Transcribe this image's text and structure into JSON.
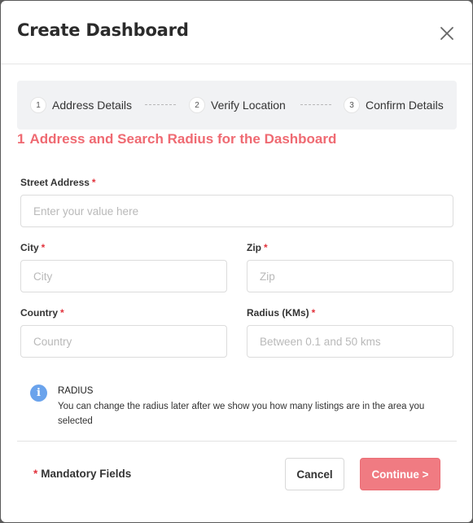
{
  "modal": {
    "title": "Create Dashboard",
    "close_icon": "close-icon"
  },
  "stepper": {
    "steps": [
      {
        "number": "1",
        "label": "Address Details"
      },
      {
        "number": "2",
        "label": "Verify Location"
      },
      {
        "number": "3",
        "label": "Confirm Details"
      }
    ]
  },
  "section": {
    "number": "1",
    "title": "Address and Search Radius for the Dashboard"
  },
  "form": {
    "required_marker": "*",
    "street": {
      "label": "Street Address",
      "value": "",
      "placeholder": "Enter your value here"
    },
    "city": {
      "label": "City",
      "value": "",
      "placeholder": "City"
    },
    "zip": {
      "label": "Zip",
      "value": "",
      "placeholder": "Zip"
    },
    "country": {
      "label": "Country",
      "value": "",
      "placeholder": "Country"
    },
    "radius": {
      "label": "Radius (KMs)",
      "value": "",
      "placeholder": "Between 0.1 and 50 kms"
    }
  },
  "info": {
    "icon": "info-icon",
    "glyph": "i",
    "title": "RADIUS",
    "text": "You can change the radius later after we show you how many listings are in the area you selected"
  },
  "footer": {
    "mandatory_marker": "*",
    "mandatory_text": "Mandatory Fields",
    "cancel_label": "Cancel",
    "continue_label": "Continue >"
  },
  "colors": {
    "accent": "#ef6a72",
    "continue_button": "#f07b82",
    "required": "#e2333d",
    "info_icon": "#6aa3ec"
  }
}
